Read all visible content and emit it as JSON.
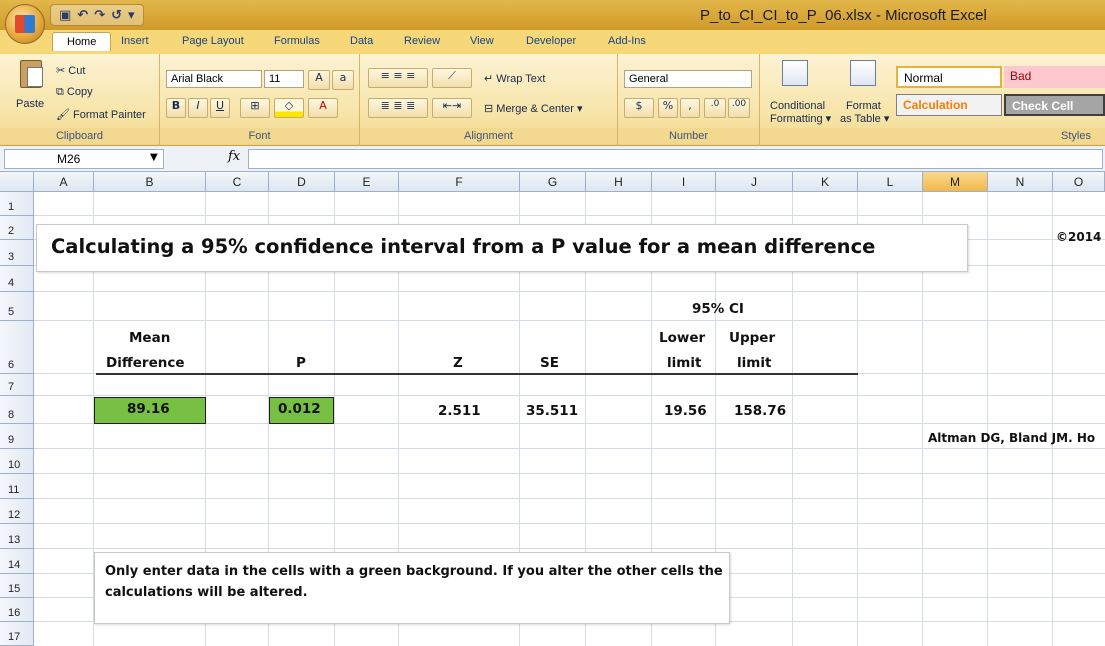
{
  "window": {
    "title": "P_to_CI_CI_to_P_06.xlsx - Microsoft Excel"
  },
  "tabs": [
    "Home",
    "Insert",
    "Page Layout",
    "Formulas",
    "Data",
    "Review",
    "View",
    "Developer",
    "Add-Ins"
  ],
  "ribbon": {
    "clipboard": {
      "paste": "Paste",
      "cut": "Cut",
      "copy": "Copy",
      "format_painter": "Format Painter",
      "label": "Clipboard"
    },
    "font": {
      "name": "Arial Black",
      "size": "11",
      "label": "Font"
    },
    "alignment": {
      "wrap_text": "Wrap Text",
      "merge_center": "Merge & Center",
      "label": "Alignment"
    },
    "number": {
      "format": "General",
      "label": "Number"
    },
    "styles": {
      "conditional": "Conditional",
      "formatting": "Formatting",
      "format": "Format",
      "as_table": "as Table",
      "normal": "Normal",
      "bad": "Bad",
      "calculation": "Calculation",
      "check_cell": "Check Cell",
      "label": "Styles"
    }
  },
  "formula_bar": {
    "name_box": "M26",
    "fx": "fx",
    "value": ""
  },
  "columns": [
    {
      "name": "A",
      "selected": false
    },
    {
      "name": "B",
      "selected": false
    },
    {
      "name": "C",
      "selected": false
    },
    {
      "name": "D",
      "selected": false
    },
    {
      "name": "E",
      "selected": false
    },
    {
      "name": "F",
      "selected": false
    },
    {
      "name": "G",
      "selected": false
    },
    {
      "name": "H",
      "selected": false
    },
    {
      "name": "I",
      "selected": false
    },
    {
      "name": "J",
      "selected": false
    },
    {
      "name": "K",
      "selected": false
    },
    {
      "name": "L",
      "selected": false
    },
    {
      "name": "M",
      "selected": true
    },
    {
      "name": "N",
      "selected": false
    },
    {
      "name": "O",
      "selected": false
    }
  ],
  "rows": [
    "1",
    "2",
    "3",
    "4",
    "5",
    "6",
    "7",
    "8",
    "9",
    "10",
    "11",
    "12",
    "13",
    "14",
    "15",
    "16",
    "17"
  ],
  "sheet": {
    "title": "Calculating a 95% confidence interval from a P value for a mean difference",
    "copyright": "©2014",
    "ci_header": "95% CI",
    "headers": {
      "mean": "Mean",
      "difference": "Difference",
      "p": "P",
      "z": "Z",
      "se": "SE",
      "lower": "Lower",
      "limit_lower": "limit",
      "upper": "Upper",
      "limit_upper": "limit"
    },
    "values": {
      "mean_difference": "89.16",
      "p": "0.012",
      "z": "2.511",
      "se": "35.511",
      "lower_limit": "19.56",
      "upper_limit": "158.76"
    },
    "citation": "Altman DG, Bland JM. Ho",
    "note": "Only enter data in the cells with a green background. If you alter the other cells the calculations will be altered."
  }
}
